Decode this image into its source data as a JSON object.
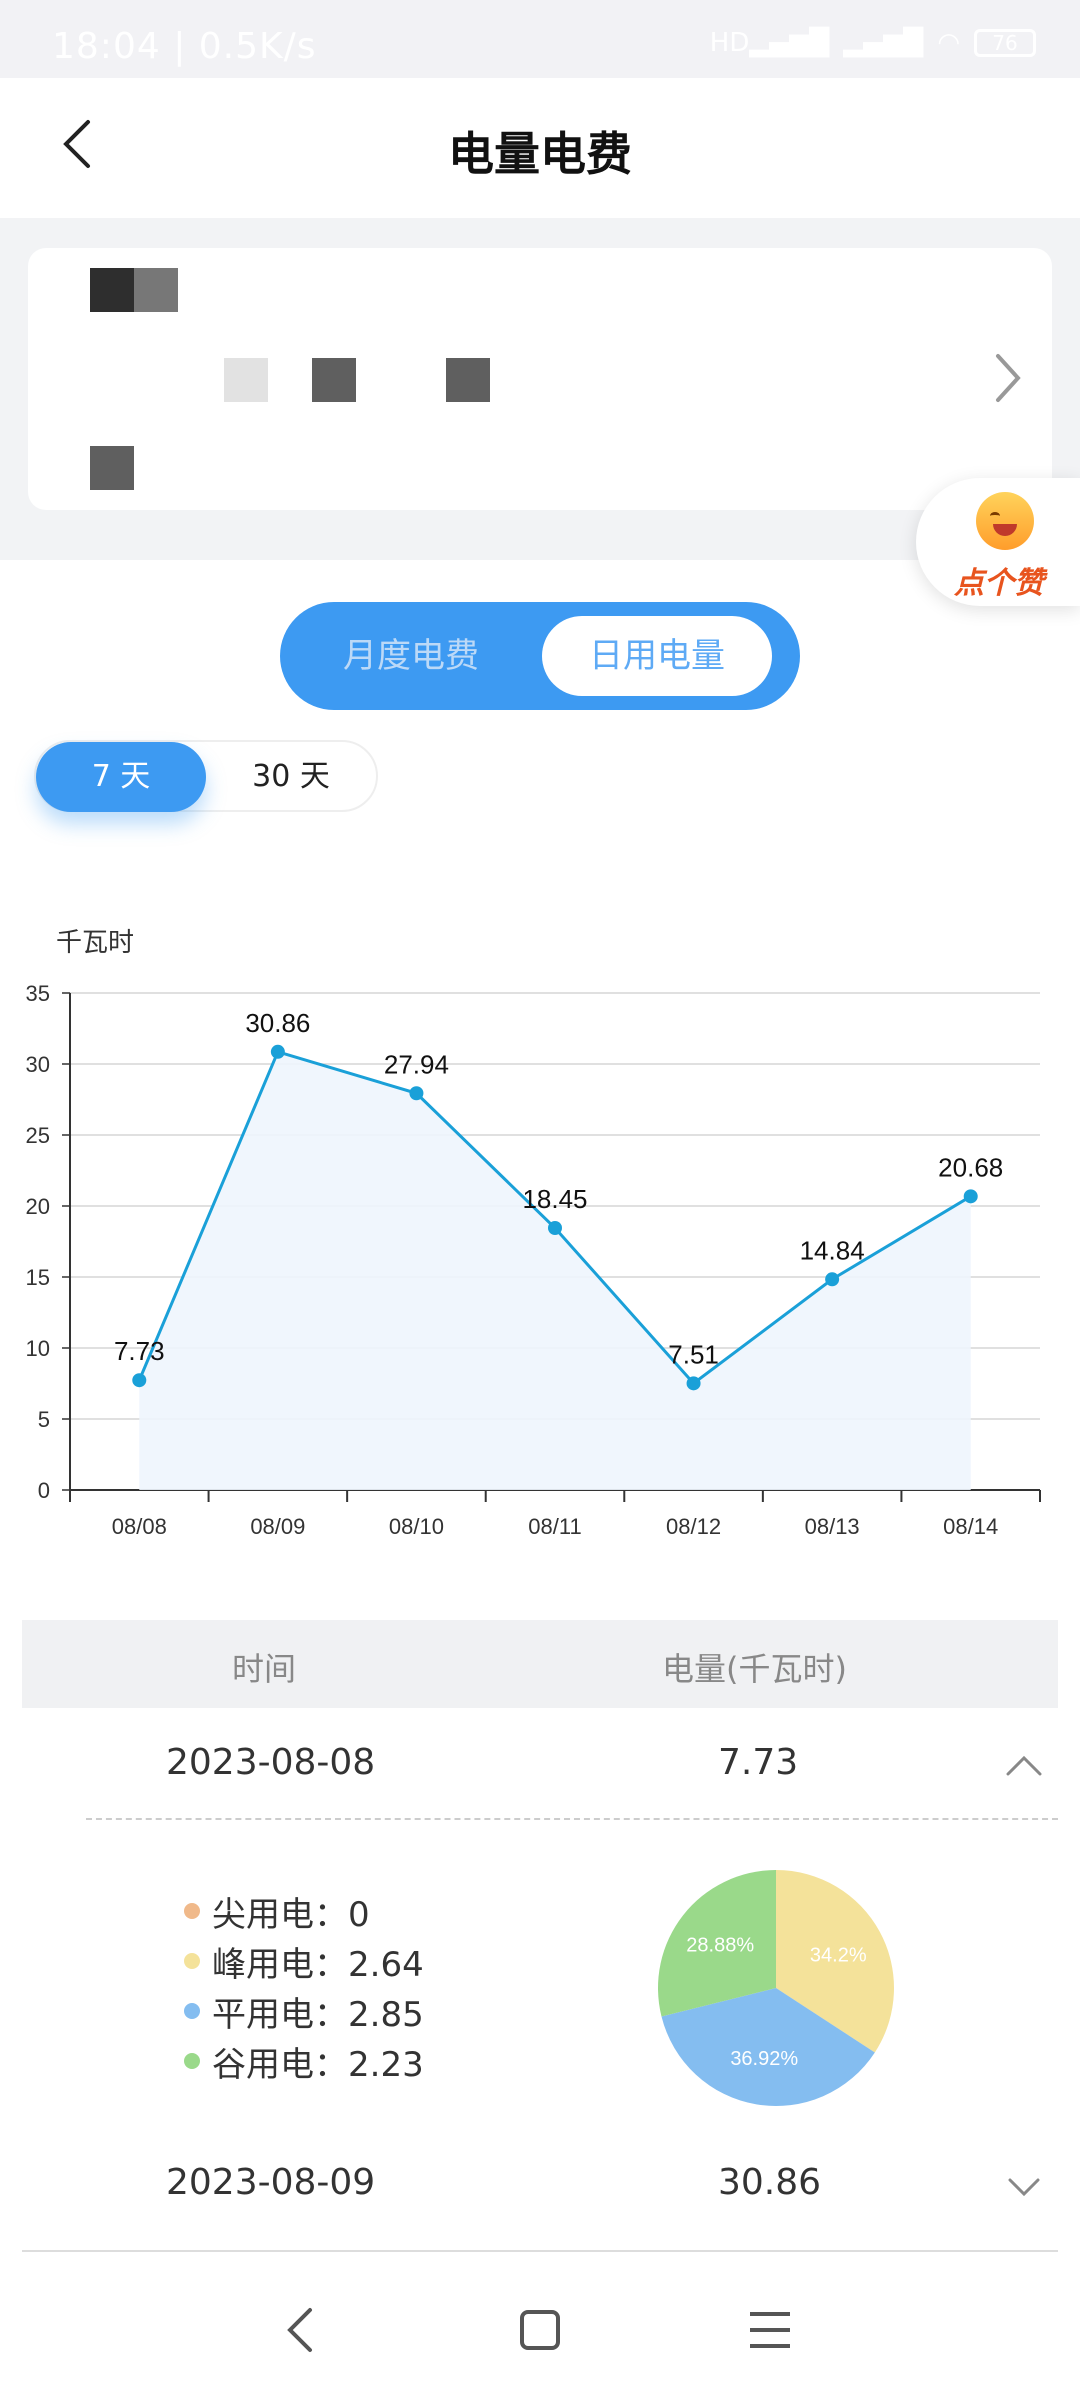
{
  "status_bar": {
    "time": "18:04 | 0.5K/s",
    "network_label": "HD",
    "battery": "76"
  },
  "header": {
    "title": "电量电费"
  },
  "like_badge": {
    "text": "点个赞"
  },
  "view_toggle": {
    "options": [
      "月度电费",
      "日用电量"
    ],
    "selected": "日用电量"
  },
  "day_range": {
    "options": [
      "7 天",
      "30 天"
    ],
    "selected": "7 天"
  },
  "colors": {
    "accent": "#3d9af2",
    "line": "#1aa0d8",
    "peak_sharp": "#f0b98a",
    "peak": "#f4e29a",
    "flat": "#84bdf0",
    "valley": "#9ad98a"
  },
  "chart_data": {
    "type": "line",
    "ylabel": "千瓦时",
    "categories": [
      "08/08",
      "08/09",
      "08/10",
      "08/11",
      "08/12",
      "08/13",
      "08/14"
    ],
    "values": [
      7.73,
      30.86,
      27.94,
      18.45,
      7.51,
      14.84,
      20.68
    ],
    "data_labels": [
      "7.73",
      "30.86",
      "27.94",
      "18.45",
      "7.51",
      "14.84",
      "20.68"
    ],
    "ylim": [
      0,
      35
    ],
    "yticks": [
      0,
      5,
      10,
      15,
      20,
      25,
      30,
      35
    ],
    "grid": true,
    "area_fill": true
  },
  "table": {
    "headers": [
      "时间",
      "电量(千瓦时)"
    ],
    "rows": [
      {
        "date": "2023-08-08",
        "value": "7.73",
        "expanded": true
      },
      {
        "date": "2023-08-09",
        "value": "30.86",
        "expanded": false
      }
    ]
  },
  "breakdown": {
    "items": [
      {
        "label": "尖用电：0",
        "value": 0
      },
      {
        "label": "峰用电：2.64",
        "value": 2.64
      },
      {
        "label": "平用电：2.85",
        "value": 2.85
      },
      {
        "label": "谷用电：2.23",
        "value": 2.23
      }
    ],
    "pie_labels": [
      "34.2%",
      "36.92%",
      "28.88%"
    ]
  }
}
